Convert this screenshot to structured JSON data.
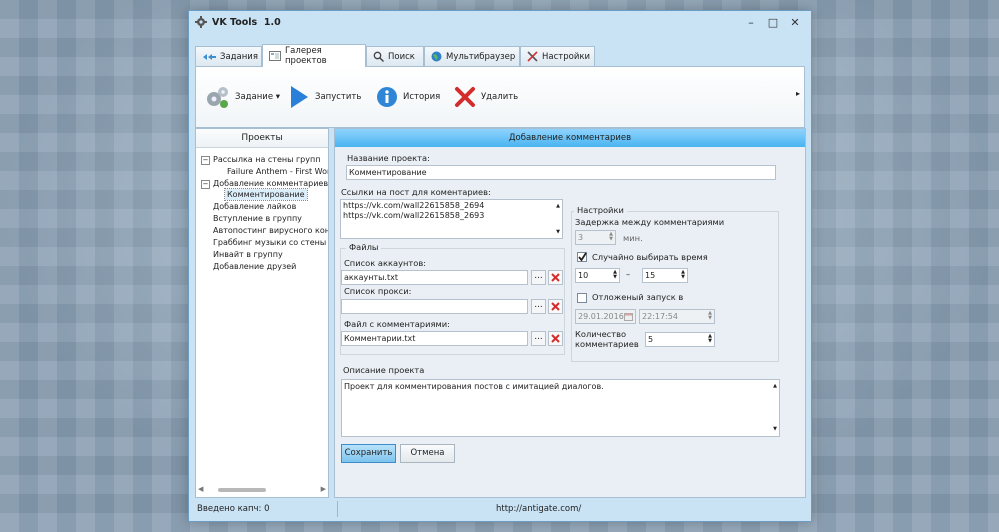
{
  "window": {
    "title": "VK Tools",
    "version": "1.0",
    "minimize": "–",
    "maximize": "□",
    "close": "✕"
  },
  "tabs": [
    {
      "label": "Задания",
      "icon": "tasks-icon"
    },
    {
      "label": "Галерея проектов",
      "icon": "gallery-icon",
      "active": true
    },
    {
      "label": "Поиск",
      "icon": "search-icon"
    },
    {
      "label": "Мультибраузер",
      "icon": "globe-icon"
    },
    {
      "label": "Настройки",
      "icon": "tools-icon"
    }
  ],
  "ribbon": {
    "task": "Задание ▾",
    "run": "Запустить",
    "history": "История",
    "delete": "Удалить",
    "more": "▸"
  },
  "projects": {
    "header": "Проекты",
    "items": [
      {
        "label": "Рассылка на стены групп",
        "expander": "−"
      },
      {
        "label": "Failure Anthem - First World P"
      },
      {
        "label": "Добавление комментариев",
        "expander": "−"
      },
      {
        "label": "Комментирование",
        "selected": true
      },
      {
        "label": "Добавление лайков"
      },
      {
        "label": "Вступление в группу"
      },
      {
        "label": "Автопостинг вирусного конте"
      },
      {
        "label": "Граббинг музыки со стены"
      },
      {
        "label": "Инвайт в группу"
      },
      {
        "label": "Добавление друзей"
      }
    ],
    "scroll_left": "◀",
    "scroll_right": "▶"
  },
  "form": {
    "header": "Добавление комментариев",
    "name_label": "Название проекта:",
    "name_value": "Комментирование",
    "links_label": "Ссылки на пост для коментариев:",
    "links": [
      "https://vk.com/wall22615858_2694",
      "https://vk.com/wall22615858_2693"
    ],
    "files_group": "Файлы",
    "accounts_label": "Список аккаунтов:",
    "accounts_value": "аккаунты.txt",
    "proxy_label": "Список прокси:",
    "proxy_value": "",
    "comments_label": "Файл с комментариями:",
    "comments_value": "Комментарии.txt",
    "browse": "...",
    "settings_group": "Настройки",
    "delay_label": "Задержка между комментариями",
    "delay_value": "3",
    "delay_unit": "мин.",
    "random_label": "Случайно выбирать время",
    "random_checked": true,
    "range_from": "10",
    "range_sep": "–",
    "range_to": "15",
    "delayed_label": "Отложеный запуск в",
    "delayed_checked": false,
    "date_value": "29.01.2016",
    "time_value": "22:17:54",
    "count_label_1": "Количество",
    "count_label_2": "комментариев",
    "count_value": "5",
    "desc_label": "Описание проекта",
    "desc_value": "Проект для комментирования постов с имитацией диалогов.",
    "save": "Сохранить",
    "cancel": "Отмена"
  },
  "status": {
    "captcha": "Введено капч: 0",
    "link": "http://antigate.com/"
  },
  "colors": {
    "accent": "#49b4ef",
    "delete_red": "#d42b2b",
    "run_blue": "#2a7fd8"
  }
}
